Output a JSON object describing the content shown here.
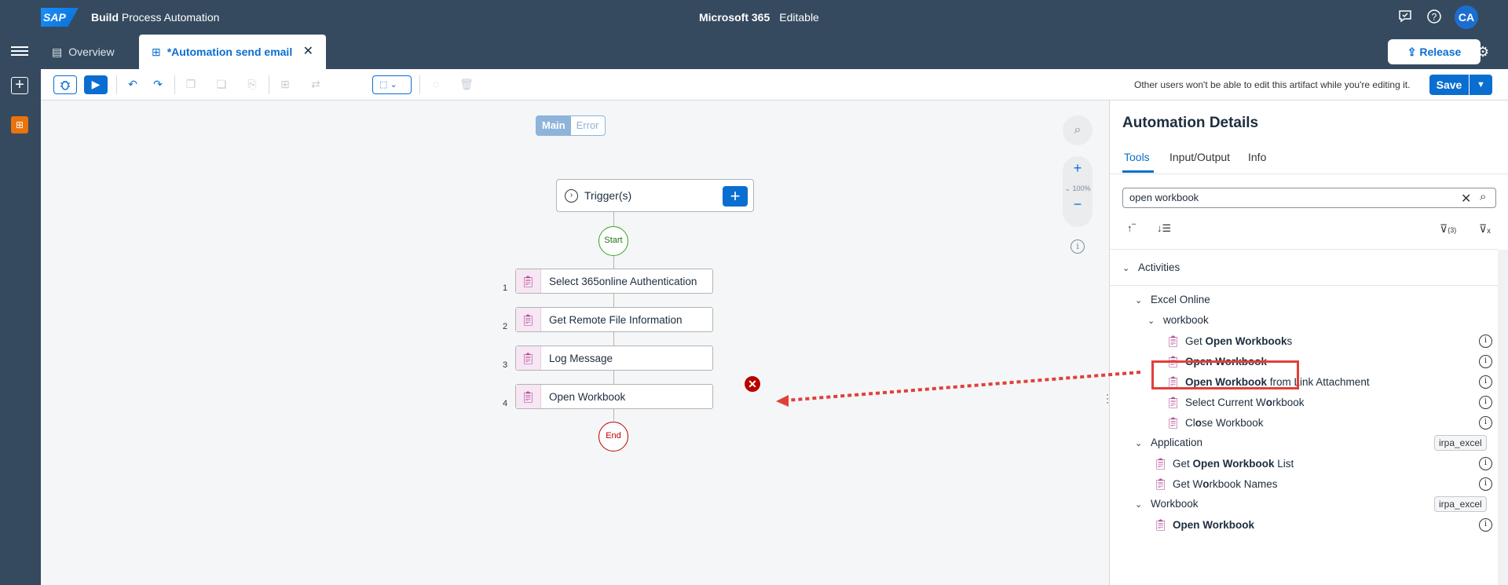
{
  "shell": {
    "logo": "SAP",
    "product_bold": "Build",
    "product_rest": "Process Automation",
    "project": "Microsoft 365",
    "mode": "Editable",
    "avatar": "CA"
  },
  "tabs": {
    "overview": "Overview",
    "active": "*Automation send email",
    "release": "Release"
  },
  "toolbar": {
    "note": "Other users won't be able to edit this artifact while you're editing it.",
    "save": "Save"
  },
  "canvas": {
    "seg_main": "Main",
    "seg_error": "Error",
    "zoom_level": "100%",
    "trigger_label": "Trigger(s)",
    "start_label": "Start",
    "end_label": "End",
    "steps": [
      {
        "num": "1",
        "label": "Select 365online Authentication"
      },
      {
        "num": "2",
        "label": "Get Remote File Information"
      },
      {
        "num": "3",
        "label": "Log Message"
      },
      {
        "num": "4",
        "label": "Open Workbook"
      }
    ]
  },
  "panel": {
    "title": "Automation Details",
    "tabs": [
      "Tools",
      "Input/Output",
      "Info"
    ],
    "search_value": "open workbook",
    "filter_count": "(3)",
    "activities_label": "Activities",
    "excel_online": "Excel Online",
    "workbook_group": "workbook",
    "excel_items": {
      "i1_a": "Get ",
      "i1_b": "Open Workbook",
      "i1_c": "s",
      "i2_b": "Open Workbook",
      "i3_b": "Open Workbook",
      "i3_c": " from Link Attachment",
      "i4_a": "Select Current W",
      "i4_b": "o",
      "i4_c": "rkbook",
      "i5_a": "Cl",
      "i5_b": "o",
      "i5_c": "se Workbook"
    },
    "application_label": "Application",
    "application_tag": "irpa_excel",
    "app_items": {
      "a1_a": "Get ",
      "a1_b": "Open Workbook",
      "a1_c": " List",
      "a2_a": "Get W",
      "a2_b": "o",
      "a2_c": "rkbook Names"
    },
    "workbook_label": "Workbook",
    "workbook_tag": "irpa_excel",
    "wb_items": {
      "w1_b": "Open Workbook"
    }
  },
  "colors": {
    "shell": "#354a5f",
    "accent": "#0a6ed1",
    "activity_icon": "#a93e8b",
    "highlight": "#e0403a",
    "error": "#bb0000",
    "start": "#36a41d"
  }
}
